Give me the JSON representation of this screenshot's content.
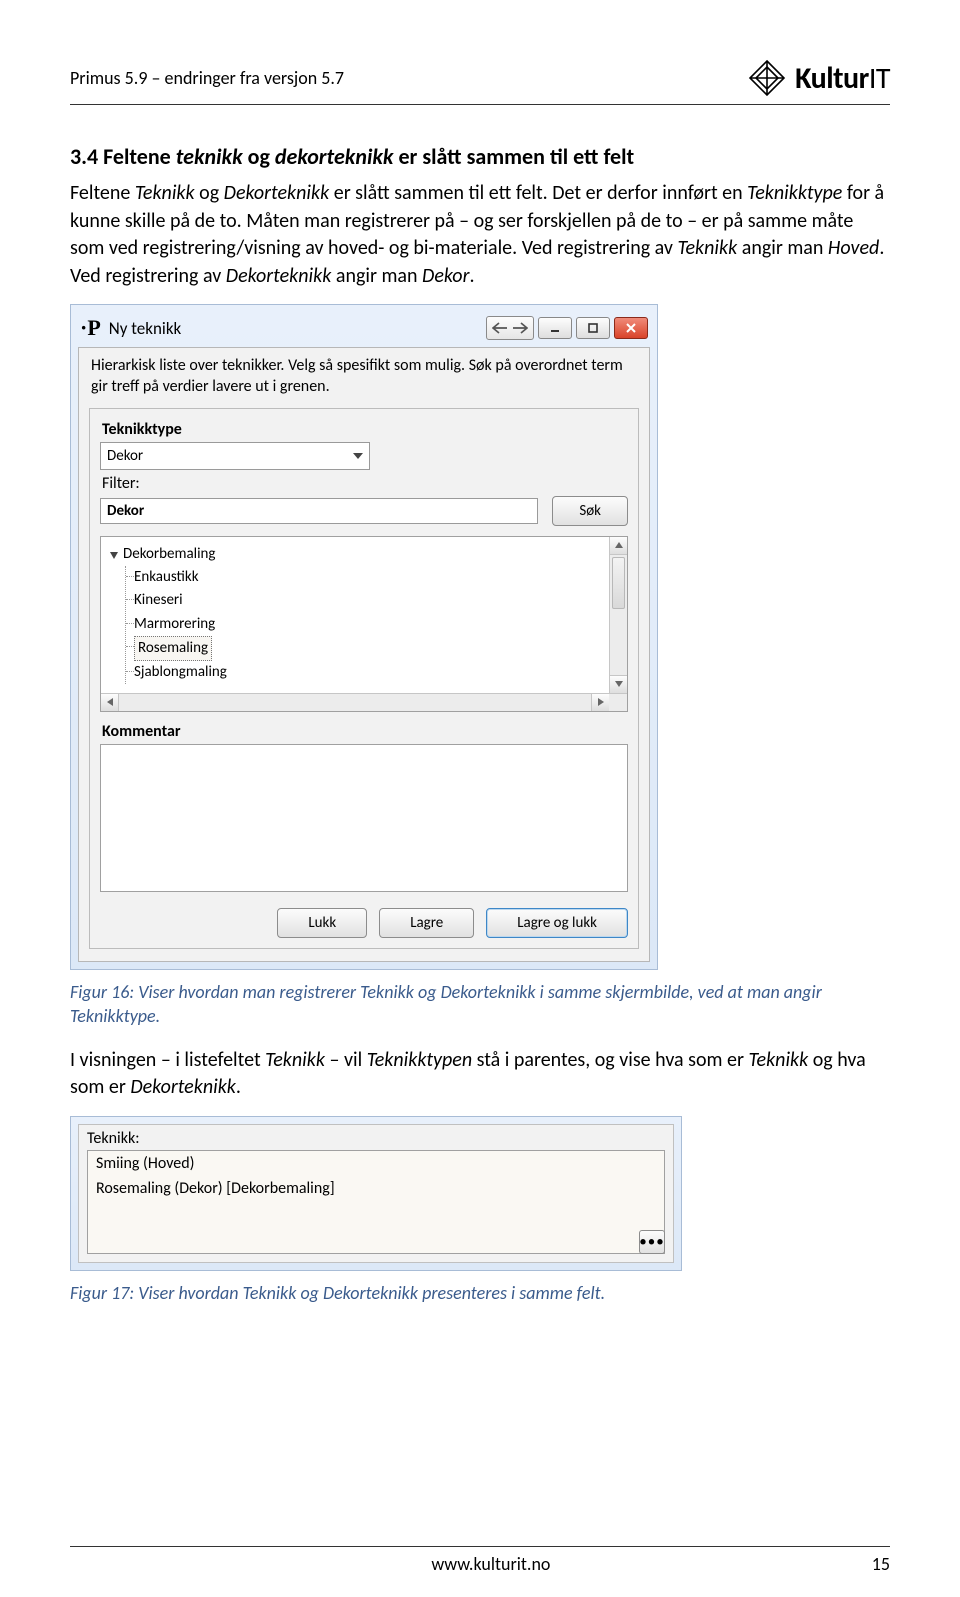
{
  "header": {
    "title": "Primus 5.9 – endringer fra versjon 5.7",
    "logo_text": "Kultur",
    "logo_suffix": "IT"
  },
  "section_heading": "3.4 Feltene teknikk og dekorteknikk er slått sammen til ett felt",
  "para1": {
    "t1": "Feltene ",
    "i1": "Teknikk",
    "t2": " og ",
    "i2": "Dekorteknikk",
    "t3": " er slått sammen til ett felt. Det er derfor innført en ",
    "i3": "Teknikktype",
    "t4": " for å kunne skille på de to. Måten man registrerer på – og ser forskjellen på de to – er på samme måte som ved registrering/visning av hoved- og bi-materiale. Ved registrering av ",
    "i4": "Teknikk",
    "t5": " angir man ",
    "i5": "Hoved",
    "t6": ". Ved registrering av ",
    "i6": "Dekorteknikk",
    "t7": " angir man ",
    "i7": "Dekor",
    "t8": "."
  },
  "fig1": {
    "title": "Ny teknikk",
    "info": "Hierarkisk liste over teknikker. Velg så spesifikt som mulig. Søk på overordnet term gir treff på verdier lavere ut i grenen.",
    "type_label": "Teknikktype",
    "type_value": "Dekor",
    "filter_label": "Filter:",
    "filter_value": "Dekor",
    "search_btn": "Søk",
    "tree_root": "Dekorbemaling",
    "tree_items": [
      "Enkaustikk",
      "Kineseri",
      "Marmorering",
      "Rosemaling",
      "Sjablongmaling"
    ],
    "tree_selected": "Rosemaling",
    "comment_label": "Kommentar",
    "btn_close": "Lukk",
    "btn_save": "Lagre",
    "btn_save_close": "Lagre og lukk"
  },
  "caption1": "Figur 16: Viser hvordan man registrerer Teknikk og Dekorteknikk i samme skjermbilde, ved at man angir Teknikktype.",
  "para2": {
    "t1": "I visningen – i listefeltet ",
    "i1": "Teknikk",
    "t2": " – vil ",
    "i2": "Teknikktypen",
    "t3": " stå i parentes, og vise hva som er ",
    "i3": "Teknikk",
    "t4": " og hva som er ",
    "i4": "Dekorteknikk",
    "t5": "."
  },
  "fig2": {
    "label": "Teknikk:",
    "row1": "Smiing (Hoved)",
    "row2": "Rosemaling (Dekor) [Dekorbemaling]"
  },
  "caption2": "Figur 17: Viser hvordan Teknikk og Dekorteknikk presenteres i samme felt.",
  "footer": {
    "url": "www.kulturit.no",
    "page": "15"
  }
}
